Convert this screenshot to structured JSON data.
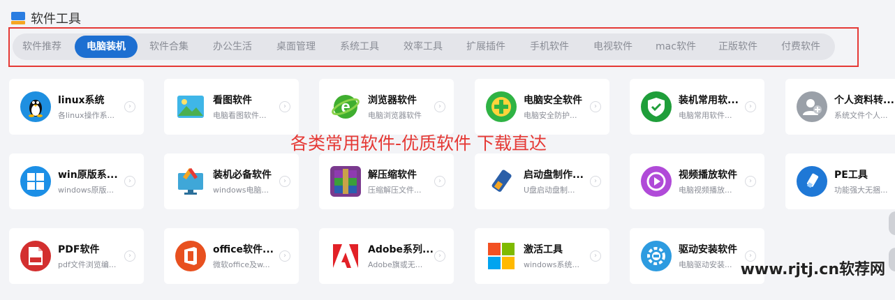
{
  "header": {
    "title": "软件工具",
    "icon": "folder-icon"
  },
  "tabs": [
    {
      "label": "软件推荐",
      "active": false
    },
    {
      "label": "电脑装机",
      "active": true
    },
    {
      "label": "软件合集",
      "active": false
    },
    {
      "label": "办公生活",
      "active": false
    },
    {
      "label": "桌面管理",
      "active": false
    },
    {
      "label": "系统工具",
      "active": false
    },
    {
      "label": "效率工具",
      "active": false
    },
    {
      "label": "扩展插件",
      "active": false
    },
    {
      "label": "手机软件",
      "active": false
    },
    {
      "label": "电视软件",
      "active": false
    },
    {
      "label": "mac软件",
      "active": false
    },
    {
      "label": "正版软件",
      "active": false
    },
    {
      "label": "付费软件",
      "active": false
    }
  ],
  "cards": [
    {
      "title": "linux系统",
      "desc": "各linux操作系...",
      "icon": "linux-penguin-icon",
      "color": "#1e8fe0"
    },
    {
      "title": "看图软件",
      "desc": "电脑看图软件...",
      "icon": "image-viewer-icon",
      "color": "#3fb6e8"
    },
    {
      "title": "浏览器软件",
      "desc": "电脑浏览器软件",
      "icon": "browser-icon",
      "color": "#3fae2f"
    },
    {
      "title": "电脑安全软件",
      "desc": "电脑安全防护...",
      "icon": "security-plus-icon",
      "color": "#2fb344"
    },
    {
      "title": "装机常用软...",
      "desc": "电脑常用软件...",
      "icon": "shield-check-icon",
      "color": "#1f9e3a"
    },
    {
      "title": "个人资料转...",
      "desc": "系统文件个人...",
      "icon": "user-plus-icon",
      "color": "#9aa0a8"
    },
    {
      "title": "win原版系...",
      "desc": "windows原版...",
      "icon": "windows-icon",
      "color": "#1c8fe6"
    },
    {
      "title": "装机必备软件",
      "desc": "windows电脑...",
      "icon": "monitor-tools-icon",
      "color": "#3fa7d8"
    },
    {
      "title": "解压缩软件",
      "desc": "压缩解压文件...",
      "icon": "winrar-icon",
      "color": "#7a3a8e"
    },
    {
      "title": "启动盘制作...",
      "desc": "U盘启动盘制...",
      "icon": "usb-drive-icon",
      "color": "#2b5fa8"
    },
    {
      "title": "视频播放软件",
      "desc": "电脑视频播放...",
      "icon": "play-icon",
      "color": "#b04ad8"
    },
    {
      "title": "PE工具",
      "desc": "功能强大无捆...",
      "icon": "usb-icon",
      "color": "#1f78d6"
    },
    {
      "title": "PDF软件",
      "desc": "pdf文件浏览编...",
      "icon": "pdf-icon",
      "color": "#d32f2f"
    },
    {
      "title": "office软件...",
      "desc": "微软office及w...",
      "icon": "office-icon",
      "color": "#e8501f"
    },
    {
      "title": "Adobe系列...",
      "desc": "Adobe旗或无...",
      "icon": "adobe-icon",
      "color": "#e22127"
    },
    {
      "title": "激活工具",
      "desc": "windows系统...",
      "icon": "windows-color-icon",
      "color": "#f25022"
    },
    {
      "title": "驱动安装软件",
      "desc": "电脑驱动安装...",
      "icon": "driver-gear-icon",
      "color": "#2d9be0"
    }
  ],
  "overlay_text": "各类常用软件-优质软件 下载直达",
  "watermark": "www.rjtj.cn软荐网"
}
